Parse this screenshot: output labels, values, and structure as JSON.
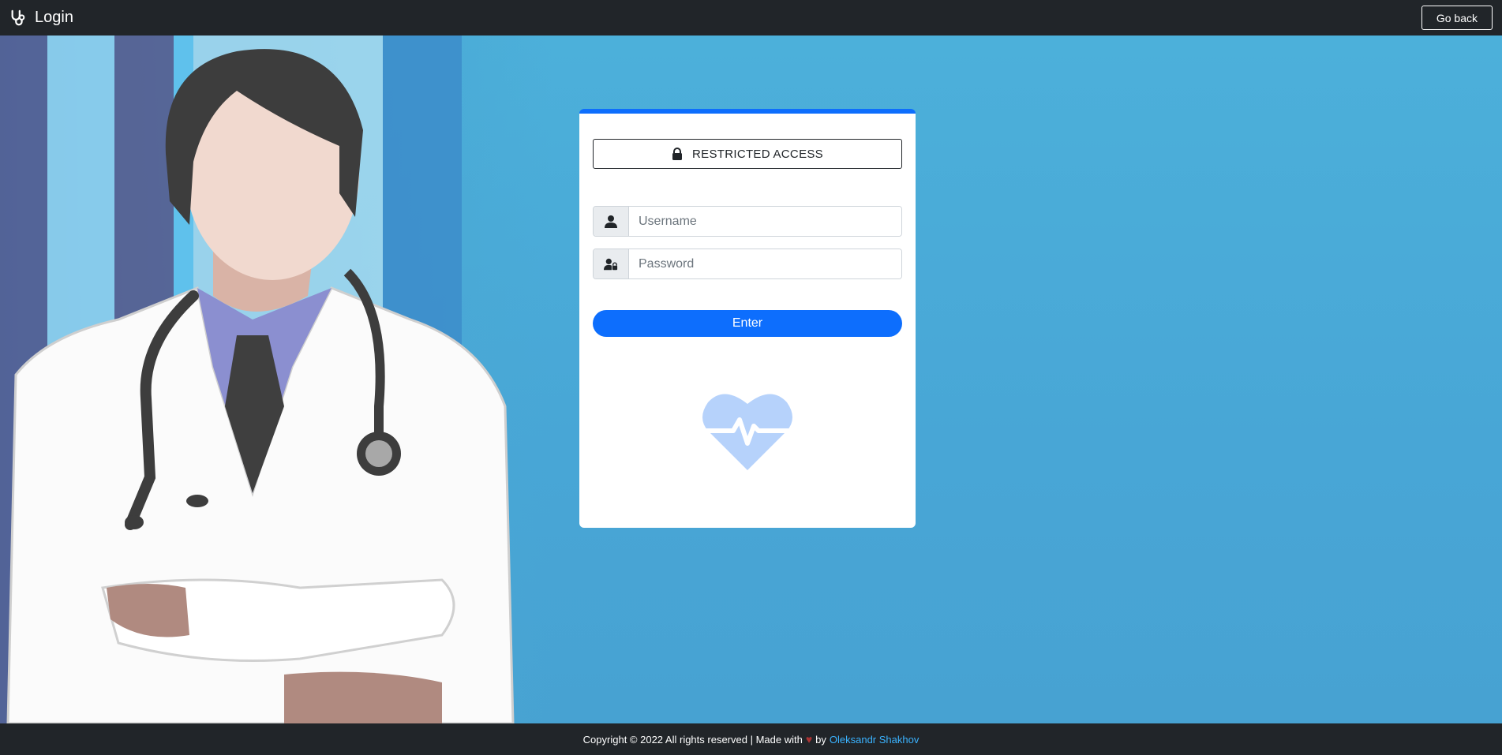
{
  "navbar": {
    "brand_label": "Login",
    "brand_icon": "stethoscope-icon",
    "go_back_label": "Go back"
  },
  "login_card": {
    "restricted_label": "RESTRICTED ACCESS",
    "restricted_icon": "lock-icon",
    "username": {
      "placeholder": "Username",
      "value": "",
      "icon": "user-icon"
    },
    "password": {
      "placeholder": "Password",
      "value": "",
      "icon": "user-lock-icon"
    },
    "enter_label": "Enter",
    "logo_icon": "heart-pulse-icon"
  },
  "footer": {
    "copyright_text": "Copyright © 2022 All rights reserved | Made with",
    "heart_glyph": "♥",
    "by_text": "by",
    "author_name": "Oleksandr Shakhov"
  },
  "colors": {
    "navbar_bg": "#212529",
    "background": "#4aa8d4",
    "accent": "#0d6efd",
    "author_link": "#3bb3ff"
  }
}
